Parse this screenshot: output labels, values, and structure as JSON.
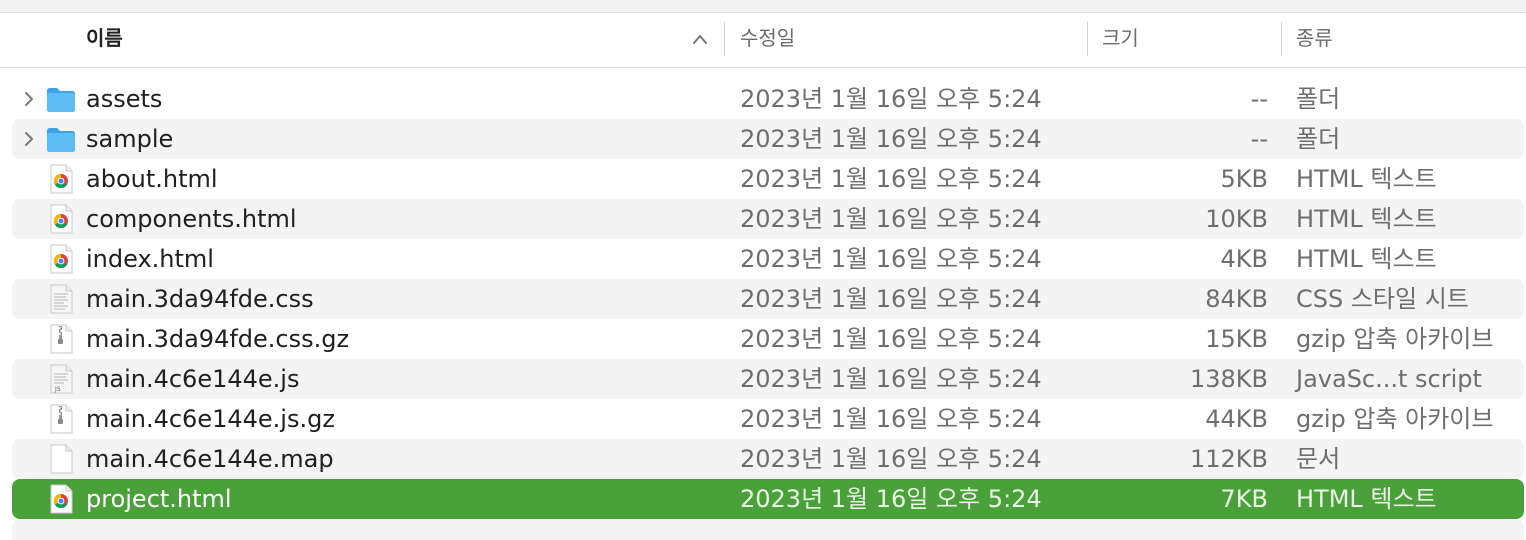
{
  "columns": {
    "name": "이름",
    "date": "수정일",
    "size": "크기",
    "kind": "종류"
  },
  "files": [
    {
      "name": "assets",
      "date": "2023년 1월 16일 오후 5:24",
      "size": "--",
      "kind": "폴더",
      "icon": "folder-icon",
      "expandable": true
    },
    {
      "name": "sample",
      "date": "2023년 1월 16일 오후 5:24",
      "size": "--",
      "kind": "폴더",
      "icon": "folder-icon",
      "expandable": true
    },
    {
      "name": "about.html",
      "date": "2023년 1월 16일 오후 5:24",
      "size": "5KB",
      "kind": "HTML 텍스트",
      "icon": "chrome-html-icon"
    },
    {
      "name": "components.html",
      "date": "2023년 1월 16일 오후 5:24",
      "size": "10KB",
      "kind": "HTML 텍스트",
      "icon": "chrome-html-icon"
    },
    {
      "name": "index.html",
      "date": "2023년 1월 16일 오후 5:24",
      "size": "4KB",
      "kind": "HTML 텍스트",
      "icon": "chrome-html-icon"
    },
    {
      "name": "main.3da94fde.css",
      "date": "2023년 1월 16일 오후 5:24",
      "size": "84KB",
      "kind": "CSS 스타일 시트",
      "icon": "css-file-icon"
    },
    {
      "name": "main.3da94fde.css.gz",
      "date": "2023년 1월 16일 오후 5:24",
      "size": "15KB",
      "kind": "gzip 압축 아카이브",
      "icon": "archive-file-icon"
    },
    {
      "name": "main.4c6e144e.js",
      "date": "2023년 1월 16일 오후 5:24",
      "size": "138KB",
      "kind": "JavaSc...t script",
      "icon": "js-file-icon"
    },
    {
      "name": "main.4c6e144e.js.gz",
      "date": "2023년 1월 16일 오후 5:24",
      "size": "44KB",
      "kind": "gzip 압축 아카이브",
      "icon": "archive-file-icon"
    },
    {
      "name": "main.4c6e144e.map",
      "date": "2023년 1월 16일 오후 5:24",
      "size": "112KB",
      "kind": "문서",
      "icon": "document-file-icon"
    },
    {
      "name": "project.html",
      "date": "2023년 1월 16일 오후 5:24",
      "size": "7KB",
      "kind": "HTML 텍스트",
      "icon": "chrome-html-icon",
      "selected": true
    }
  ],
  "colors": {
    "selection": "#4aa13a",
    "folder": "#4fb0ef",
    "stripe": "#f4f4f4"
  }
}
